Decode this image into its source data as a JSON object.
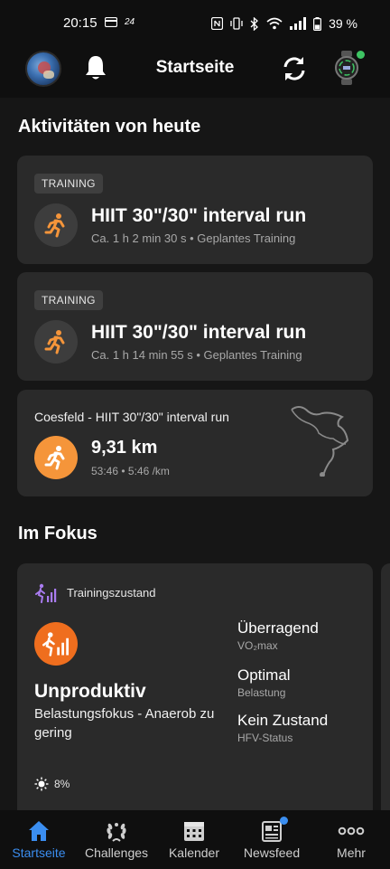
{
  "status_bar": {
    "time": "20:15",
    "extra": "24",
    "battery_text": "39 %",
    "icons": [
      "card-icon",
      "nfc-icon",
      "vibrate-icon",
      "bluetooth-icon",
      "wifi-icon",
      "signal-icon",
      "battery-icon"
    ]
  },
  "header": {
    "title": "Startseite",
    "icons": [
      "avatar",
      "bell-icon",
      "sync-icon",
      "watch-icon"
    ],
    "watch_status_color": "#3ec463"
  },
  "today": {
    "title": "Aktivitäten von heute",
    "activities": [
      {
        "badge": "TRAINING",
        "title": "HIIT 30\"/30\" interval run",
        "subtitle": "Ca. 1 h 2 min 30 s • Geplantes Training",
        "icon": "running-icon"
      },
      {
        "badge": "TRAINING",
        "title": "HIIT 30\"/30\" interval run",
        "subtitle": "Ca. 1 h 14 min 55 s • Geplantes Training",
        "icon": "running-icon"
      }
    ],
    "completed": {
      "title": "Coesfeld - HIIT 30\"/30\" interval run",
      "distance": "9,31 km",
      "details": "53:46 • 5:46 /km",
      "icon": "running-icon",
      "accent": "#f5953a"
    }
  },
  "focus": {
    "title": "Im Fokus",
    "card": {
      "header_label": "Trainingszustand",
      "status": "Unproduktiv",
      "focus_text": "Belastungsfokus - Anaerob zu gering",
      "metrics": [
        {
          "value": "Überragend",
          "label": "VO₂max"
        },
        {
          "value": "Optimal",
          "label": "Belastung"
        },
        {
          "value": "Kein Zustand",
          "label": "HFV-Status"
        }
      ],
      "sun_value": "8%",
      "accent": "#ef6e1e"
    }
  },
  "nav": {
    "items": [
      {
        "label": "Startseite",
        "icon": "home-icon",
        "active": true
      },
      {
        "label": "Challenges",
        "icon": "laurel-icon"
      },
      {
        "label": "Kalender",
        "icon": "calendar-icon"
      },
      {
        "label": "Newsfeed",
        "icon": "newsfeed-icon"
      },
      {
        "label": "Mehr",
        "icon": "more-icon"
      }
    ],
    "active_color": "#3b8ef0"
  }
}
